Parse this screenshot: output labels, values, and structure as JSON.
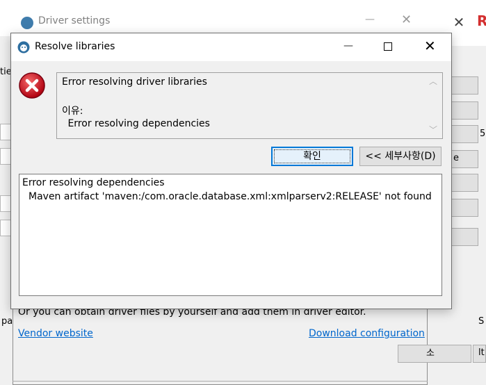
{
  "background_window": {
    "side_texts": [
      "tie",
      "5",
      "e",
      "S",
      "lt",
      "pa",
      "소"
    ]
  },
  "driver_settings": {
    "title": "Driver settings",
    "info_text": "Or you can obtain driver files by yourself and add them in driver editor.",
    "vendor_link": "Vendor website",
    "download_link": "Download configuration"
  },
  "resolve_dialog": {
    "title": "Resolve libraries",
    "message_lines": [
      "Error resolving driver libraries",
      "이유:",
      " Error resolving dependencies"
    ],
    "ok_label": "확인",
    "details_label": "<< 세부사항(D)",
    "details_lines": [
      "Error resolving dependencies",
      "Maven artifact 'maven:/com.oracle.database.xml:xmlparserv2:RELEASE' not found"
    ]
  },
  "colors": {
    "link": "#0066cc",
    "error_red": "#d0021b",
    "focus_border": "#0078d7"
  },
  "icons": {
    "error": "error-icon",
    "app": "dbeaver-icon",
    "minimize": "minimize-icon",
    "maximize": "maximize-icon",
    "close": "close-icon"
  }
}
